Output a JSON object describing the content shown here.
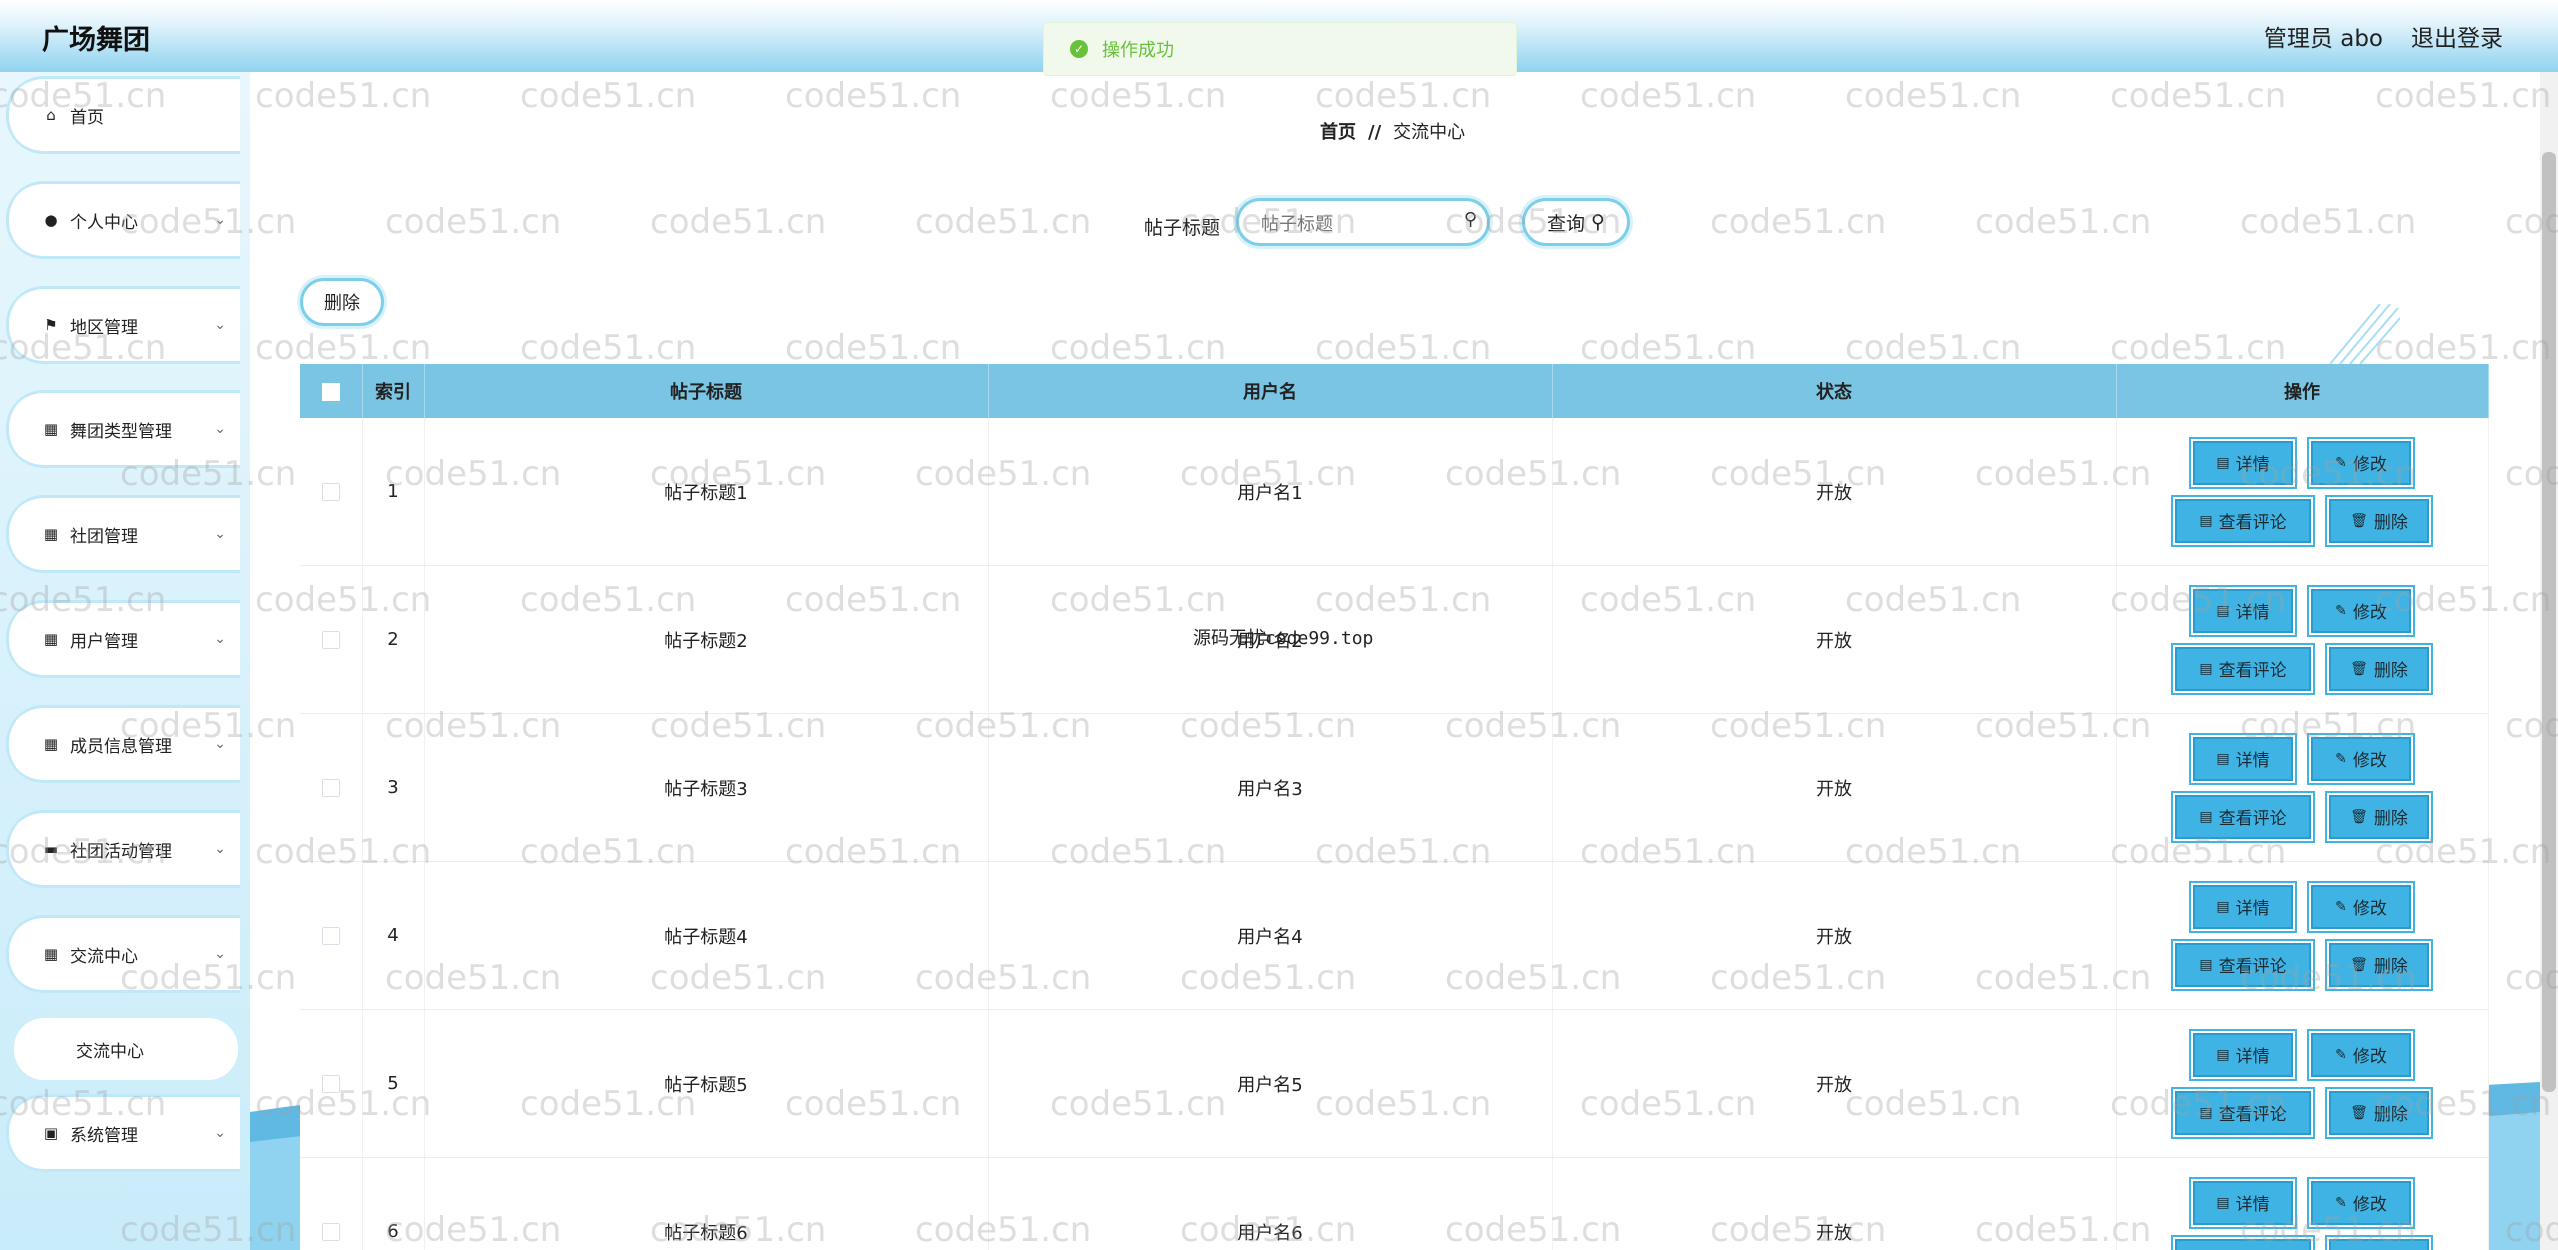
{
  "header": {
    "title": "广场舞团",
    "admin": "管理员 abo",
    "logout": "退出登录"
  },
  "toast": {
    "text": "操作成功"
  },
  "sidebar": {
    "items": [
      {
        "label": "首页",
        "icon": "home-icon",
        "glyph": "⌂"
      },
      {
        "label": "个人中心",
        "icon": "user-icon",
        "glyph": "●"
      },
      {
        "label": "地区管理",
        "icon": "flag-icon",
        "glyph": "⚑"
      },
      {
        "label": "舞团类型管理",
        "icon": "grid-icon",
        "glyph": "▦"
      },
      {
        "label": "社团管理",
        "icon": "grid-icon",
        "glyph": "▦"
      },
      {
        "label": "用户管理",
        "icon": "grid-icon",
        "glyph": "▦"
      },
      {
        "label": "成员信息管理",
        "icon": "grid-icon",
        "glyph": "▦"
      },
      {
        "label": "社团活动管理",
        "icon": "monitor-icon",
        "glyph": "▬"
      },
      {
        "label": "交流中心",
        "icon": "grid-icon",
        "glyph": "▦"
      },
      {
        "label": "系统管理",
        "icon": "briefcase-icon",
        "glyph": "▣"
      }
    ],
    "submenu": {
      "label": "交流中心"
    }
  },
  "breadcrumb": {
    "home": "首页",
    "sep": "//",
    "current": "交流中心"
  },
  "search": {
    "label": "帖子标题",
    "placeholder": "帖子标题",
    "query_label": "查询"
  },
  "toolbar": {
    "delete_label": "删除"
  },
  "table": {
    "headers": [
      "索引",
      "帖子标题",
      "用户名",
      "状态",
      "操作"
    ],
    "rows": [
      {
        "index": "1",
        "title": "帖子标题1",
        "user": "用户名1",
        "status": "开放"
      },
      {
        "index": "2",
        "title": "帖子标题2",
        "user": "用户名2",
        "status": "开放"
      },
      {
        "index": "3",
        "title": "帖子标题3",
        "user": "用户名3",
        "status": "开放"
      },
      {
        "index": "4",
        "title": "帖子标题4",
        "user": "用户名4",
        "status": "开放"
      },
      {
        "index": "5",
        "title": "帖子标题5",
        "user": "用户名5",
        "status": "开放"
      },
      {
        "index": "6",
        "title": "帖子标题6",
        "user": "用户名6",
        "status": "开放"
      }
    ],
    "actions": {
      "detail": "详情",
      "edit": "修改",
      "comments": "查看评论",
      "delete": "删除"
    }
  },
  "watermark": {
    "text": "code51.cn"
  },
  "overlay": {
    "text": "源码无忧code99.top"
  },
  "colors": {
    "header_bg": "#8fd3f0",
    "table_header": "#79c5e3",
    "op_button": "#3fb4e4",
    "toast_green": "#67c23a"
  }
}
